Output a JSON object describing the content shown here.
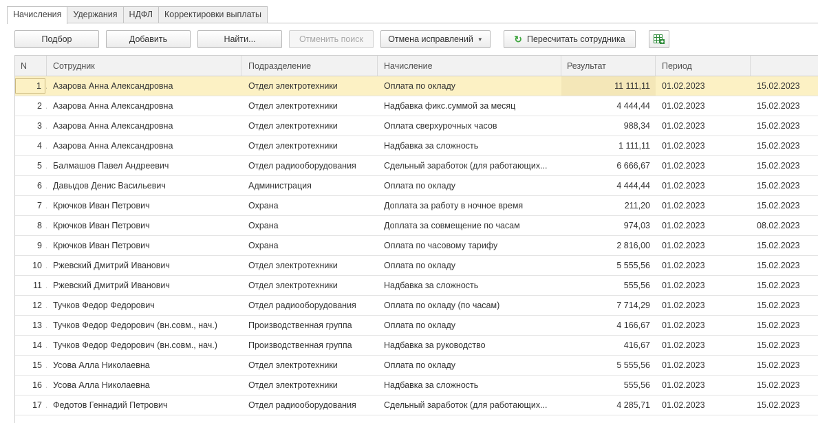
{
  "tabs": [
    {
      "label": "Начисления",
      "active": true
    },
    {
      "label": "Удержания",
      "active": false
    },
    {
      "label": "НДФЛ",
      "active": false
    },
    {
      "label": "Корректировки выплаты",
      "active": false
    }
  ],
  "toolbar": {
    "select_label": "Подбор",
    "add_label": "Добавить",
    "find_label": "Найти...",
    "cancel_search_label": "Отменить поиск",
    "cancel_corrections_label": "Отмена исправлений",
    "recalculate_label": "Пересчитать сотрудника"
  },
  "table": {
    "columns": [
      "N",
      "Сотрудник",
      "Подразделение",
      "Начисление",
      "Результат",
      "Период",
      ""
    ],
    "rows": [
      {
        "n": "1",
        "employee": "Азарова Анна Александровна",
        "department": "Отдел электротехники",
        "accrual": "Оплата по окладу",
        "result": "11 111,11",
        "period": "01.02.2023",
        "end": "15.02.2023",
        "selected": true
      },
      {
        "n": "2",
        "employee": "Азарова Анна Александровна",
        "department": "Отдел электротехники",
        "accrual": "Надбавка фикс.суммой за месяц",
        "result": "4 444,44",
        "period": "01.02.2023",
        "end": "15.02.2023"
      },
      {
        "n": "3",
        "employee": "Азарова Анна Александровна",
        "department": "Отдел электротехники",
        "accrual": "Оплата сверхурочных часов",
        "result": "988,34",
        "period": "01.02.2023",
        "end": "15.02.2023"
      },
      {
        "n": "4",
        "employee": "Азарова Анна Александровна",
        "department": "Отдел электротехники",
        "accrual": "Надбавка за сложность",
        "result": "1 111,11",
        "period": "01.02.2023",
        "end": "15.02.2023"
      },
      {
        "n": "5",
        "employee": "Балмашов Павел Андреевич",
        "department": "Отдел радиооборудования",
        "accrual": "Сдельный заработок (для работающих...",
        "result": "6 666,67",
        "period": "01.02.2023",
        "end": "15.02.2023"
      },
      {
        "n": "6",
        "employee": "Давыдов Денис Васильевич",
        "department": "Администрация",
        "accrual": "Оплата по окладу",
        "result": "4 444,44",
        "period": "01.02.2023",
        "end": "15.02.2023"
      },
      {
        "n": "7",
        "employee": "Крючков Иван Петрович",
        "department": "Охрана",
        "accrual": "Доплата за работу в ночное время",
        "result": "211,20",
        "period": "01.02.2023",
        "end": "15.02.2023"
      },
      {
        "n": "8",
        "employee": "Крючков Иван Петрович",
        "department": "Охрана",
        "accrual": "Доплата за совмещение по часам",
        "result": "974,03",
        "period": "01.02.2023",
        "end": "08.02.2023"
      },
      {
        "n": "9",
        "employee": "Крючков Иван Петрович",
        "department": "Охрана",
        "accrual": "Оплата по часовому тарифу",
        "result": "2 816,00",
        "period": "01.02.2023",
        "end": "15.02.2023"
      },
      {
        "n": "10",
        "employee": "Ржевский Дмитрий Иванович",
        "department": "Отдел электротехники",
        "accrual": "Оплата по окладу",
        "result": "5 555,56",
        "period": "01.02.2023",
        "end": "15.02.2023"
      },
      {
        "n": "11",
        "employee": "Ржевский Дмитрий Иванович",
        "department": "Отдел электротехники",
        "accrual": "Надбавка за сложность",
        "result": "555,56",
        "period": "01.02.2023",
        "end": "15.02.2023"
      },
      {
        "n": "12",
        "employee": "Тучков Федор Федорович",
        "department": "Отдел радиооборудования",
        "accrual": "Оплата по окладу (по часам)",
        "result": "7 714,29",
        "period": "01.02.2023",
        "end": "15.02.2023"
      },
      {
        "n": "13",
        "employee": "Тучков Федор Федорович (вн.совм., нач.)",
        "department": "Производственная группа",
        "accrual": "Оплата по окладу",
        "result": "4 166,67",
        "period": "01.02.2023",
        "end": "15.02.2023"
      },
      {
        "n": "14",
        "employee": "Тучков Федор Федорович (вн.совм., нач.)",
        "department": "Производственная группа",
        "accrual": "Надбавка за руководство",
        "result": "416,67",
        "period": "01.02.2023",
        "end": "15.02.2023"
      },
      {
        "n": "15",
        "employee": "Усова Алла Николаевна",
        "department": "Отдел электротехники",
        "accrual": "Оплата по окладу",
        "result": "5 555,56",
        "period": "01.02.2023",
        "end": "15.02.2023"
      },
      {
        "n": "16",
        "employee": "Усова Алла Николаевна",
        "department": "Отдел электротехники",
        "accrual": "Надбавка за сложность",
        "result": "555,56",
        "period": "01.02.2023",
        "end": "15.02.2023"
      },
      {
        "n": "17",
        "employee": "Федотов Геннадий Петрович",
        "department": "Отдел радиооборудования",
        "accrual": "Сдельный заработок (для работающих...",
        "result": "4 285,71",
        "period": "01.02.2023",
        "end": "15.02.2023"
      }
    ]
  },
  "colors": {
    "selected_row": "#fcf1c4",
    "header_bg": "#f2f2f2",
    "refresh_icon": "#3fa63f",
    "excel_icon": "#2e8b3a"
  },
  "icons": {
    "refresh": "refresh-icon",
    "excel": "excel-export-icon",
    "dropdown": "chevron-down-icon"
  }
}
